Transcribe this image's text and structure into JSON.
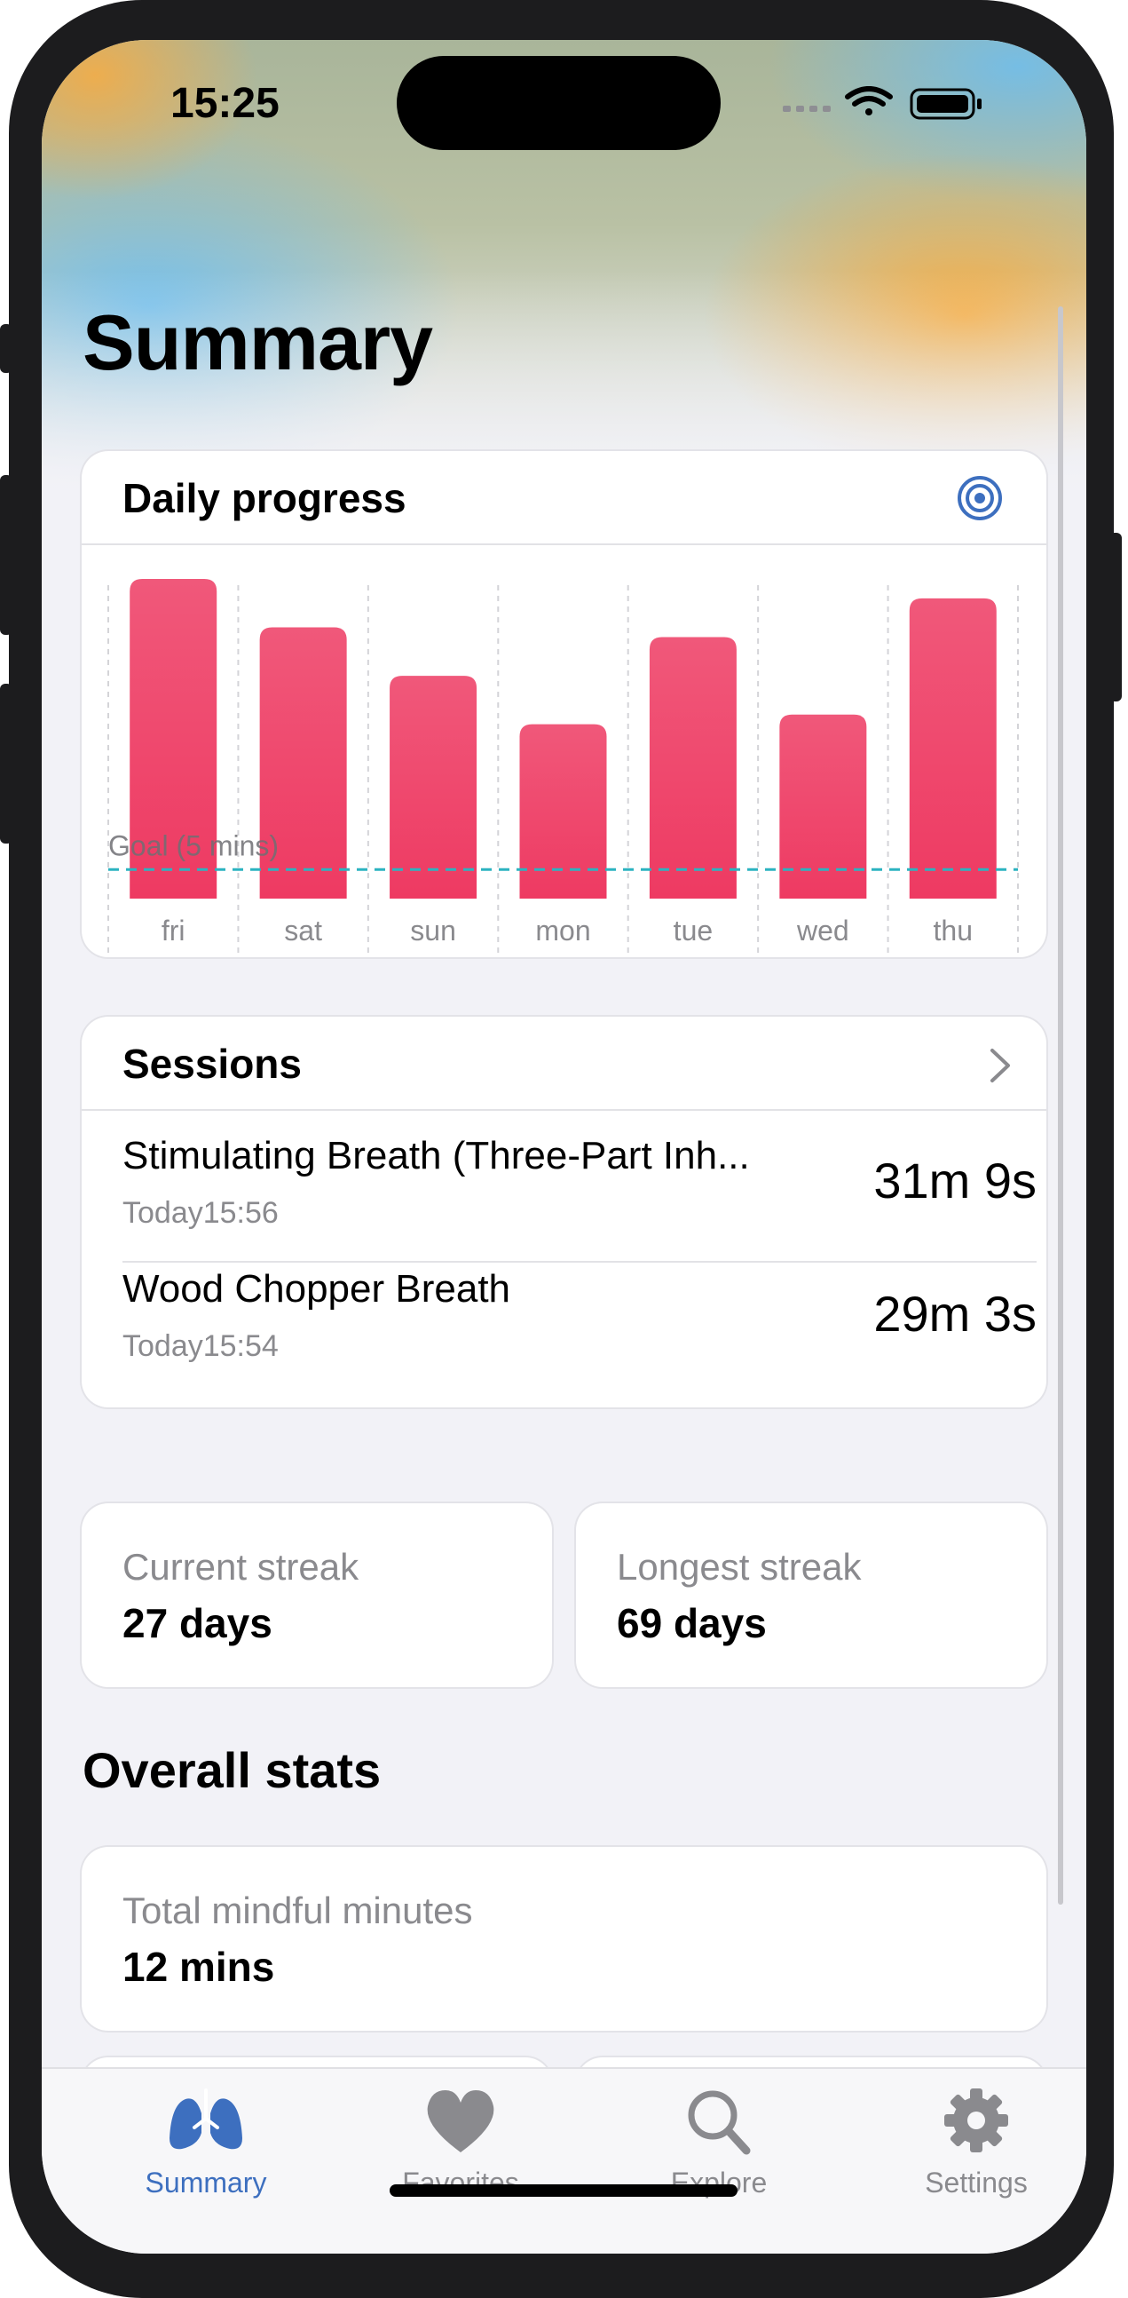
{
  "status_bar": {
    "time": "15:25"
  },
  "page": {
    "title": "Summary"
  },
  "daily_progress": {
    "title": "Daily progress",
    "goal_label": "Goal (5 mins)"
  },
  "chart_data": {
    "type": "bar",
    "categories": [
      "fri",
      "sat",
      "sun",
      "mon",
      "tue",
      "wed",
      "thu"
    ],
    "values": [
      33,
      28,
      23,
      18,
      27,
      19,
      31
    ],
    "goal": 3,
    "ylim": [
      0,
      33
    ],
    "title": "Daily progress",
    "goal_label": "Goal (5 mins)",
    "bar_color": "#ee3a62",
    "goal_line_color": "#2bb3c0"
  },
  "sessions": {
    "title": "Sessions",
    "items": [
      {
        "name": "Stimulating Breath (Three-Part Inh...",
        "time": "Today15:56",
        "duration": "31m 9s"
      },
      {
        "name": "Wood Chopper Breath",
        "time": "Today15:54",
        "duration": "29m 3s"
      }
    ]
  },
  "streaks": {
    "current": {
      "label": "Current streak",
      "value": "27 days"
    },
    "longest": {
      "label": "Longest streak",
      "value": "69 days"
    }
  },
  "overall_stats": {
    "title": "Overall stats",
    "total_mindful": {
      "label": "Total mindful minutes",
      "value": "12 mins"
    }
  },
  "tab_bar": {
    "tabs": [
      {
        "label": "Summary",
        "icon": "lungs-icon",
        "active": true
      },
      {
        "label": "Favorites",
        "icon": "heart-icon",
        "active": false
      },
      {
        "label": "Explore",
        "icon": "search-icon",
        "active": false
      },
      {
        "label": "Settings",
        "icon": "gear-icon",
        "active": false
      }
    ]
  },
  "colors": {
    "accent": "#3d6fbf",
    "bar": "#ee3a62",
    "background": "#f2f2f7"
  }
}
